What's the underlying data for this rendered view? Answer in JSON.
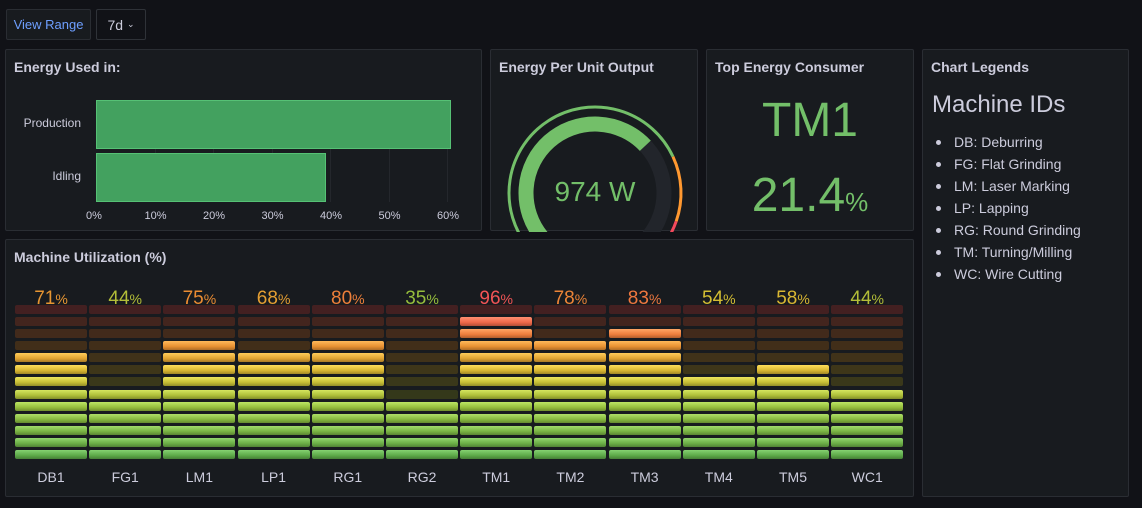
{
  "toolbar": {
    "view_range_label": "View Range",
    "range_value": "7d"
  },
  "energy_used": {
    "title": "Energy Used in:",
    "bar_color": "#43a15f",
    "chart_data": {
      "type": "bar",
      "orientation": "horizontal",
      "categories": [
        "Production",
        "Idling"
      ],
      "values": [
        60.6,
        39.4
      ],
      "xticks": [
        "0%",
        "10%",
        "20%",
        "30%",
        "40%",
        "50%",
        "60%"
      ],
      "xlim": [
        0,
        62
      ]
    }
  },
  "energy_per_unit": {
    "title": "Energy Per Unit Output",
    "value_text": "974 W",
    "gauge_level": 0.68,
    "thresholds": [
      {
        "color": "#73bf69",
        "upto": 0.75
      },
      {
        "color": "#ff9830",
        "upto": 0.92
      },
      {
        "color": "#f2495c",
        "upto": 1.0
      }
    ]
  },
  "top_consumer": {
    "title": "Top Energy Consumer",
    "machine": "TM1",
    "value": "21.4",
    "unit": "%",
    "color": "#73bf69"
  },
  "legend": {
    "title": "Chart Legends",
    "heading": "Machine IDs",
    "items": [
      "DB: Deburring",
      "FG: Flat Grinding",
      "LM: Laser Marking",
      "LP: Lapping",
      "RG: Round Grinding",
      "TM: Turning/Milling",
      "WC: Wire Cutting"
    ]
  },
  "utilization": {
    "title": "Machine Utilization (%)",
    "unit": "%",
    "machines": [
      {
        "name": "DB1",
        "value": 71
      },
      {
        "name": "FG1",
        "value": 44
      },
      {
        "name": "LM1",
        "value": 75
      },
      {
        "name": "LP1",
        "value": 68
      },
      {
        "name": "RG1",
        "value": 80
      },
      {
        "name": "RG2",
        "value": 35
      },
      {
        "name": "TM1",
        "value": 96
      },
      {
        "name": "TM2",
        "value": 78
      },
      {
        "name": "TM3",
        "value": 83
      },
      {
        "name": "TM4",
        "value": 54
      },
      {
        "name": "TM5",
        "value": 58
      },
      {
        "name": "WC1",
        "value": 44
      }
    ]
  }
}
